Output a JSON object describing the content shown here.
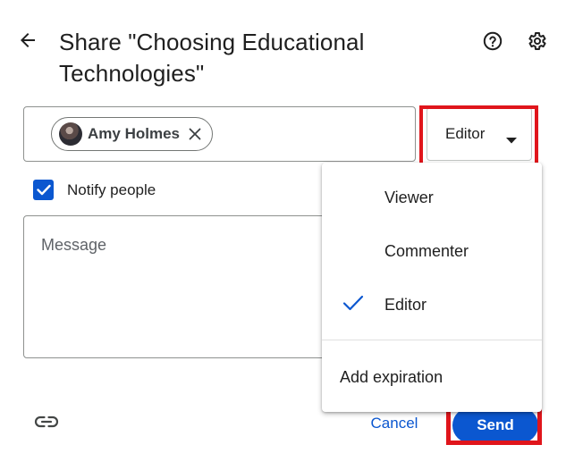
{
  "dialog": {
    "title": "Share \"Choosing Educational Technologies\"",
    "back_icon": "arrow-back-icon",
    "help_icon": "help-circle-icon",
    "settings_icon": "gear-icon"
  },
  "people": {
    "chips": [
      {
        "name": "Amy Holmes",
        "avatar_icon": "user-avatar",
        "remove_icon": "close-icon"
      }
    ]
  },
  "role_selector": {
    "selected": "Editor",
    "caret_icon": "caret-down-icon"
  },
  "notify": {
    "label": "Notify people",
    "checked": true
  },
  "message": {
    "placeholder": "Message"
  },
  "role_menu": {
    "items": [
      {
        "label": "Viewer",
        "selected": false
      },
      {
        "label": "Commenter",
        "selected": false
      },
      {
        "label": "Editor",
        "selected": true
      }
    ],
    "extra_item": "Add expiration",
    "check_icon": "checkmark-icon"
  },
  "footer": {
    "link_icon": "link-icon",
    "cancel_label": "Cancel",
    "send_label": "Send"
  },
  "colors": {
    "accent": "#0b57d0",
    "highlight": "#e0151b",
    "text": "#1f1f1f",
    "border": "#8e918f"
  }
}
